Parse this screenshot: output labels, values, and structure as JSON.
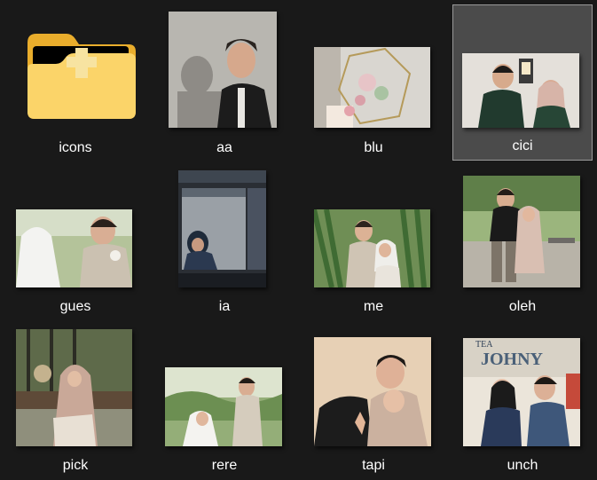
{
  "explorer": {
    "view": "large-icons",
    "selected_item": "cici",
    "items": [
      {
        "name": "icons",
        "type": "folder"
      },
      {
        "name": "aa",
        "type": "image"
      },
      {
        "name": "blu",
        "type": "image"
      },
      {
        "name": "cici",
        "type": "image"
      },
      {
        "name": "gues",
        "type": "image"
      },
      {
        "name": "ia",
        "type": "image"
      },
      {
        "name": "me",
        "type": "image"
      },
      {
        "name": "oleh",
        "type": "image"
      },
      {
        "name": "pick",
        "type": "image"
      },
      {
        "name": "rere",
        "type": "image"
      },
      {
        "name": "tapi",
        "type": "image"
      },
      {
        "name": "unch",
        "type": "image"
      }
    ],
    "thumb_text": {
      "unch_sign_top": "TEA",
      "unch_sign_bottom": "JOHNY"
    }
  },
  "colors": {
    "background": "#191919",
    "selection_fill": "#4b4b4b",
    "selection_border": "#9a9a9a",
    "folder_yellow": "#f7c948",
    "label_text": "#ffffff"
  }
}
